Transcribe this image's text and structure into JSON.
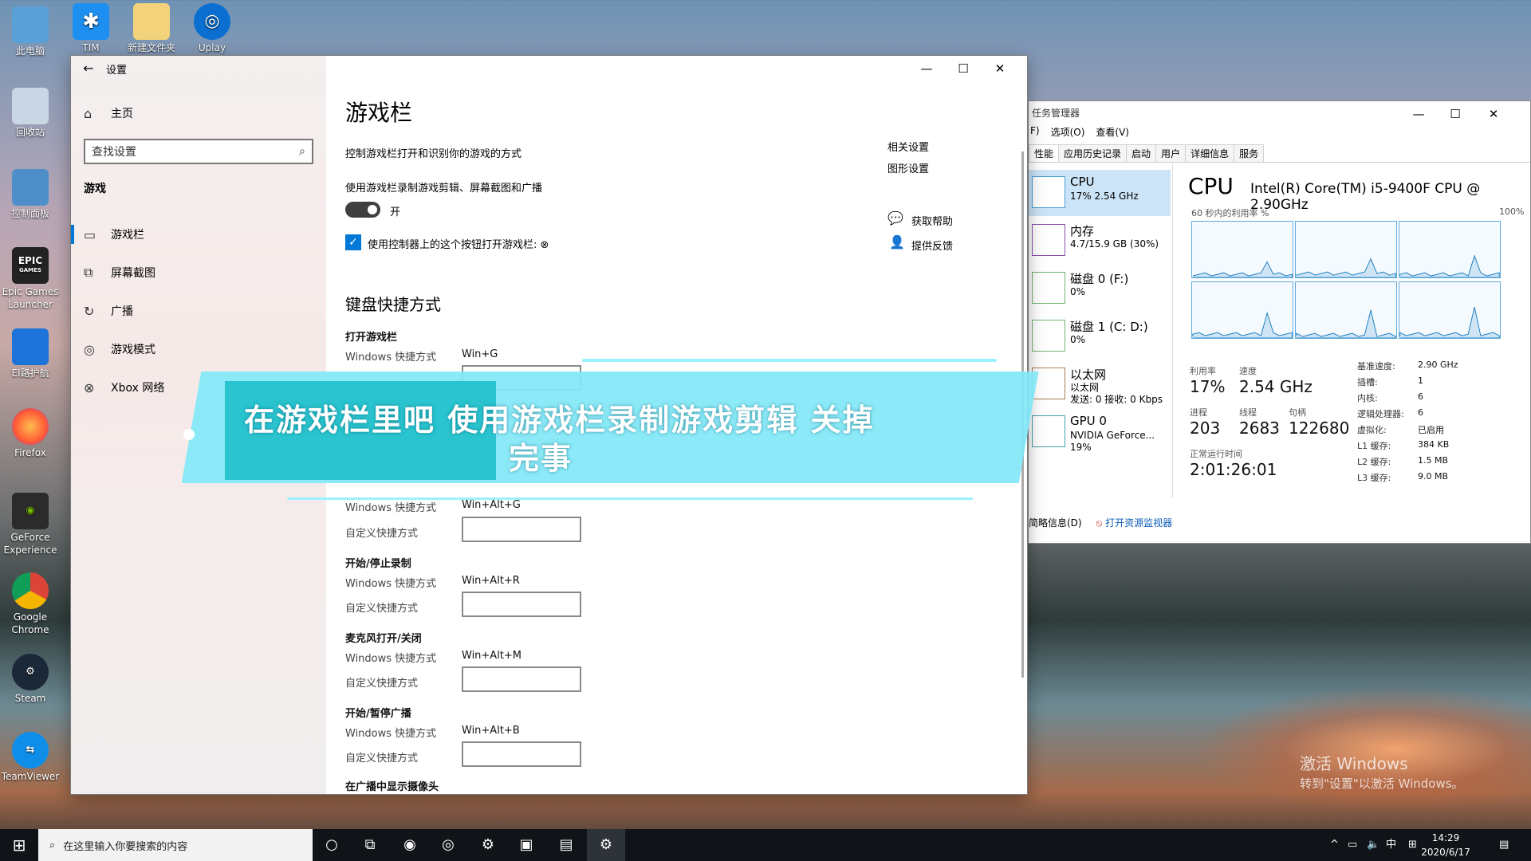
{
  "desktop": {
    "icons": [
      {
        "label": "此电脑",
        "name": "this-pc"
      },
      {
        "label": "回收站",
        "name": "recycle-bin"
      },
      {
        "label": "控制面板",
        "name": "control-panel"
      },
      {
        "label": "Epic Games Launcher",
        "name": "epic-games"
      },
      {
        "label": "EI路护航",
        "name": "ei-guard"
      },
      {
        "label": "Firefox",
        "name": "firefox"
      },
      {
        "label": "GeForce Experience",
        "name": "geforce"
      },
      {
        "label": "Google Chrome",
        "name": "chrome"
      },
      {
        "label": "Steam",
        "name": "steam"
      },
      {
        "label": "TeamViewer",
        "name": "teamviewer"
      },
      {
        "label": "TIM",
        "name": "tim"
      },
      {
        "label": "新建文件夹",
        "name": "new-folder"
      },
      {
        "label": "Uplay",
        "name": "uplay"
      }
    ],
    "epic_logo": "EPIC",
    "epic_sub": "GAMES",
    "activate_title": "激活 Windows",
    "activate_sub": "转到\"设置\"以激活 Windows。"
  },
  "settings": {
    "window_title": "设置",
    "home": "主页",
    "search_placeholder": "查找设置",
    "section": "游戏",
    "nav": [
      {
        "label": "游戏栏"
      },
      {
        "label": "屏幕截图"
      },
      {
        "label": "广播"
      },
      {
        "label": "游戏模式"
      },
      {
        "label": "Xbox 网络"
      }
    ],
    "page_title": "游戏栏",
    "description": "控制游戏栏打开和识别你的游戏的方式",
    "record_label": "使用游戏栏录制游戏剪辑、屏幕截图和广播",
    "toggle_state": "开",
    "toggle_on": true,
    "checkbox_label": "使用控制器上的这个按钮打开游戏栏:",
    "checkbox_checked": true,
    "shortcuts_title": "键盘快捷方式",
    "win_label": "Windows 快捷方式",
    "custom_label": "自定义快捷方式",
    "shortcuts": [
      {
        "name": "打开游戏栏",
        "win": "Win+G"
      },
      {
        "name": "",
        "win": "Win+Alt+G"
      },
      {
        "name": "开始/停止录制",
        "win": "Win+Alt+R"
      },
      {
        "name": "麦克风打开/关闭",
        "win": "Win+Alt+M"
      },
      {
        "name": "开始/暂停广播",
        "win": "Win+Alt+B"
      }
    ],
    "last_item": "在广播中显示摄像头",
    "related_title": "相关设置",
    "graphics_link": "图形设置",
    "help_link": "获取帮助",
    "feedback_link": "提供反馈"
  },
  "taskmgr": {
    "title": "任务管理器",
    "menu": [
      "F)",
      "选项(O)",
      "查看(V)"
    ],
    "tabs": [
      "性能",
      "应用历史记录",
      "启动",
      "用户",
      "详细信息",
      "服务"
    ],
    "side": [
      {
        "name": "CPU",
        "detail": "17% 2.54 GHz",
        "detail2": ""
      },
      {
        "name": "内存",
        "detail": "4.7/15.9 GB (30%)",
        "detail2": ""
      },
      {
        "name": "磁盘 0 (F:)",
        "detail": "0%",
        "detail2": ""
      },
      {
        "name": "磁盘 1 (C: D:)",
        "detail": "0%",
        "detail2": ""
      },
      {
        "name": "以太网",
        "detail": "以太网",
        "detail2": "发送: 0 接收: 0 Kbps"
      },
      {
        "name": "GPU 0",
        "detail": "NVIDIA GeForce...",
        "detail2": "19%"
      }
    ],
    "cpu_title": "CPU",
    "cpu_model": "Intel(R) Core(TM) i5-9400F CPU @ 2.90GHz",
    "graph_caption": "60 秒内的利用率 %",
    "graph_max": "100%",
    "stats": {
      "util_label": "利用率",
      "util": "17%",
      "speed_label": "速度",
      "speed": "2.54 GHz",
      "proc_label": "进程",
      "proc": "203",
      "thread_label": "线程",
      "thread": "2683",
      "handle_label": "句柄",
      "handle": "122680",
      "uptime_label": "正常运行时间",
      "uptime": "2:01:26:01"
    },
    "specs": [
      {
        "k": "基准速度:",
        "v": "2.90 GHz"
      },
      {
        "k": "插槽:",
        "v": "1"
      },
      {
        "k": "内核:",
        "v": "6"
      },
      {
        "k": "逻辑处理器:",
        "v": "6"
      },
      {
        "k": "虚拟化:",
        "v": "已启用"
      },
      {
        "k": "L1 缓存:",
        "v": "384 KB"
      },
      {
        "k": "L2 缓存:",
        "v": "1.5 MB"
      },
      {
        "k": "L3 缓存:",
        "v": "9.0 MB"
      }
    ],
    "fewer_details": "简略信息(D)",
    "resmon": "打开资源监视器"
  },
  "banner": {
    "line1": "在游戏栏里吧 使用游戏栏录制游戏剪辑 关掉",
    "line2": "完事"
  },
  "taskbar": {
    "search_placeholder": "在这里输入你要搜索的内容",
    "ime": "中",
    "time": "14:29",
    "date": "2020/6/17"
  }
}
